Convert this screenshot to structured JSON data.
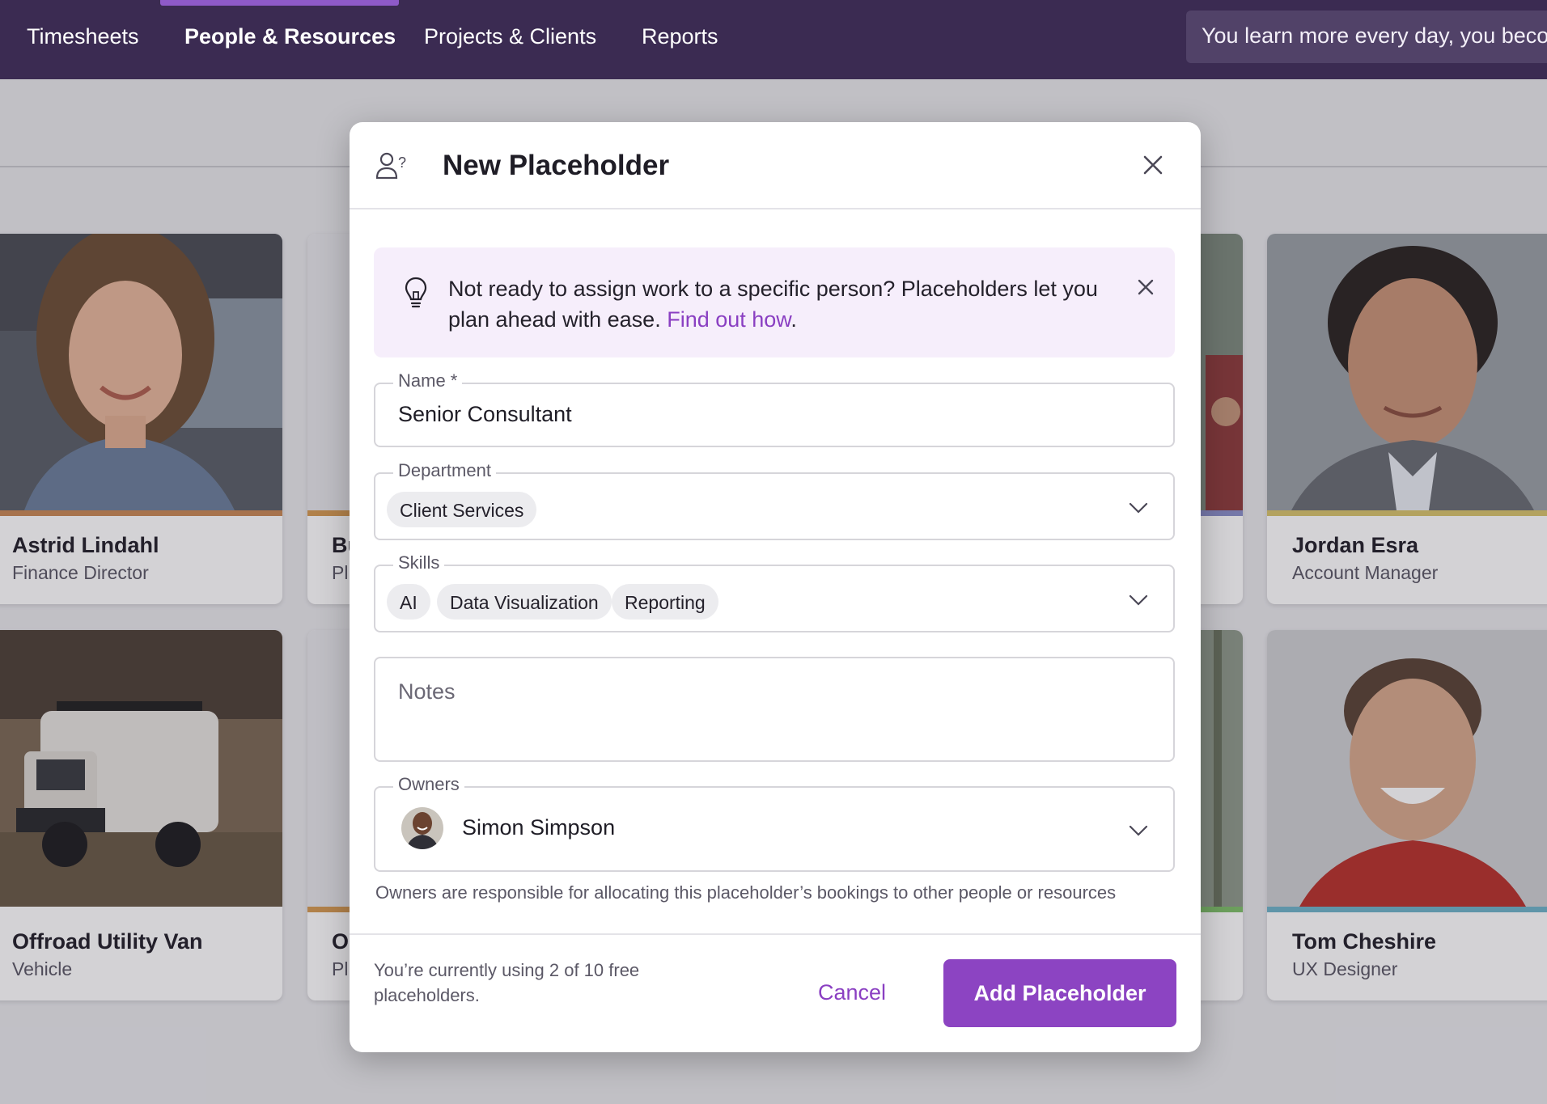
{
  "nav": {
    "items": [
      {
        "label": "Timesheets"
      },
      {
        "label": "People & Resources"
      },
      {
        "label": "Projects & Clients"
      },
      {
        "label": "Reports"
      }
    ],
    "active_item": "People & Resources",
    "tip_text": "You learn more every day, you becom"
  },
  "cards": [
    {
      "name": "Astrid Lindahl",
      "role": "Finance Director",
      "accent": "#c98955"
    },
    {
      "name": "Bu",
      "role": "Pl",
      "accent": "#d59a52"
    },
    {
      "name": "Jordan Esra",
      "role": "Account Manager",
      "accent": "#d8c46c"
    },
    {
      "name": "Offroad Utility Van",
      "role": "Vehicle",
      "accent": ""
    },
    {
      "name": "O",
      "role": "Pl",
      "accent": "#d59a52"
    },
    {
      "name": "Tom Cheshire",
      "role": "UX Designer",
      "accent": "#6fb3c9"
    }
  ],
  "modal": {
    "title": "New Placeholder",
    "banner": {
      "text": "Not ready to assign work to a specific person? Placeholders let you plan ahead with ease.",
      "link_text": "Find out how",
      "after_link": "."
    },
    "name_field": {
      "label": "Name *",
      "value": "Senior Consultant"
    },
    "department_field": {
      "label": "Department",
      "selected": "Client Services"
    },
    "skills_field": {
      "label": "Skills",
      "selected": [
        "AI",
        "Data Visualization",
        "Reporting"
      ]
    },
    "notes_field": {
      "placeholder": "Notes"
    },
    "owners_field": {
      "label": "Owners",
      "selected": "Simon Simpson"
    },
    "owners_help": "Owners are responsible for allocating this placeholder’s bookings to other people or resources",
    "footer_note": "You’re currently using 2 of 10 free placeholders.",
    "cancel_label": "Cancel",
    "submit_label": "Add Placeholder"
  },
  "colors": {
    "nav_bg": "#3b2b52",
    "accent_purple": "#8c44c2",
    "link_purple": "#8a3fc2",
    "banner_bg": "#f6eefb"
  }
}
